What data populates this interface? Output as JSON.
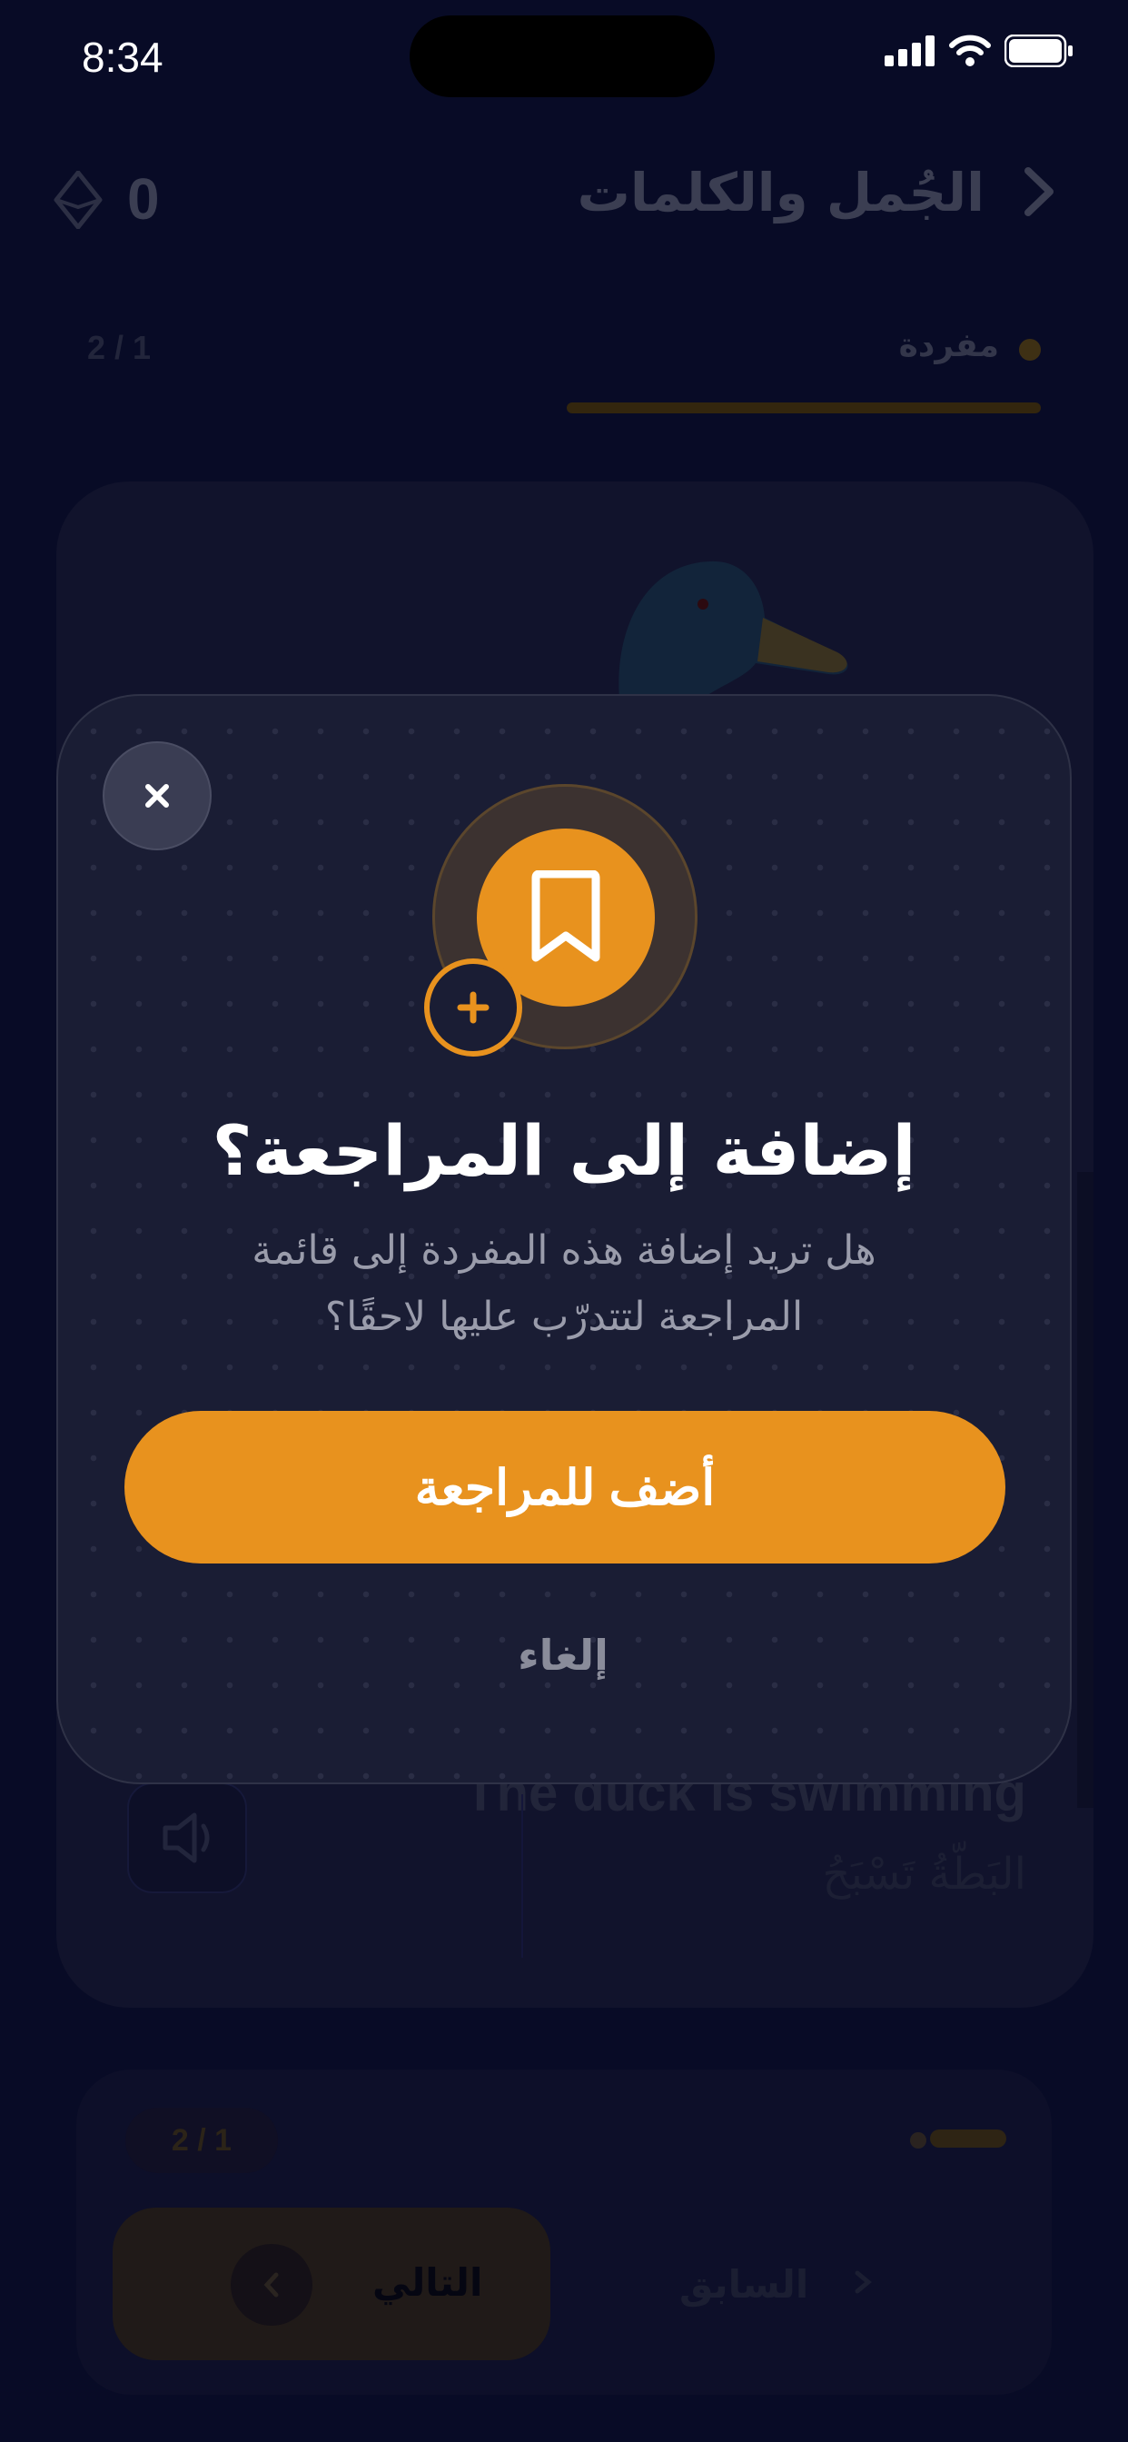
{
  "status_bar": {
    "time": "8:34"
  },
  "header": {
    "title": "الجُمل والكلمات",
    "score": "0"
  },
  "tabs": {
    "active_label": "مفردة",
    "counter": "2 / 1"
  },
  "card": {
    "sentence_en": "The duck is swimming",
    "sentence_ar": "البَطّةُ تَسْبَحُ"
  },
  "footer": {
    "counter": "2 / 1",
    "next_label": "التالي",
    "prev_label": "السابق"
  },
  "modal": {
    "title": "إضافة إلى المراجعة؟",
    "description_line1": "هل تريد إضافة هذه المفردة إلى قائمة",
    "description_line2": "المراجعة لتتدرّب عليها لاحقًا؟",
    "confirm_label": "أضف للمراجعة",
    "cancel_label": "إلغاء",
    "close_icon": "close-icon",
    "main_icon": "bookmark-icon",
    "badge_icon": "plus-icon"
  },
  "colors": {
    "accent": "#e8921e",
    "background": "#080b26",
    "modal": "#1a1d34"
  }
}
